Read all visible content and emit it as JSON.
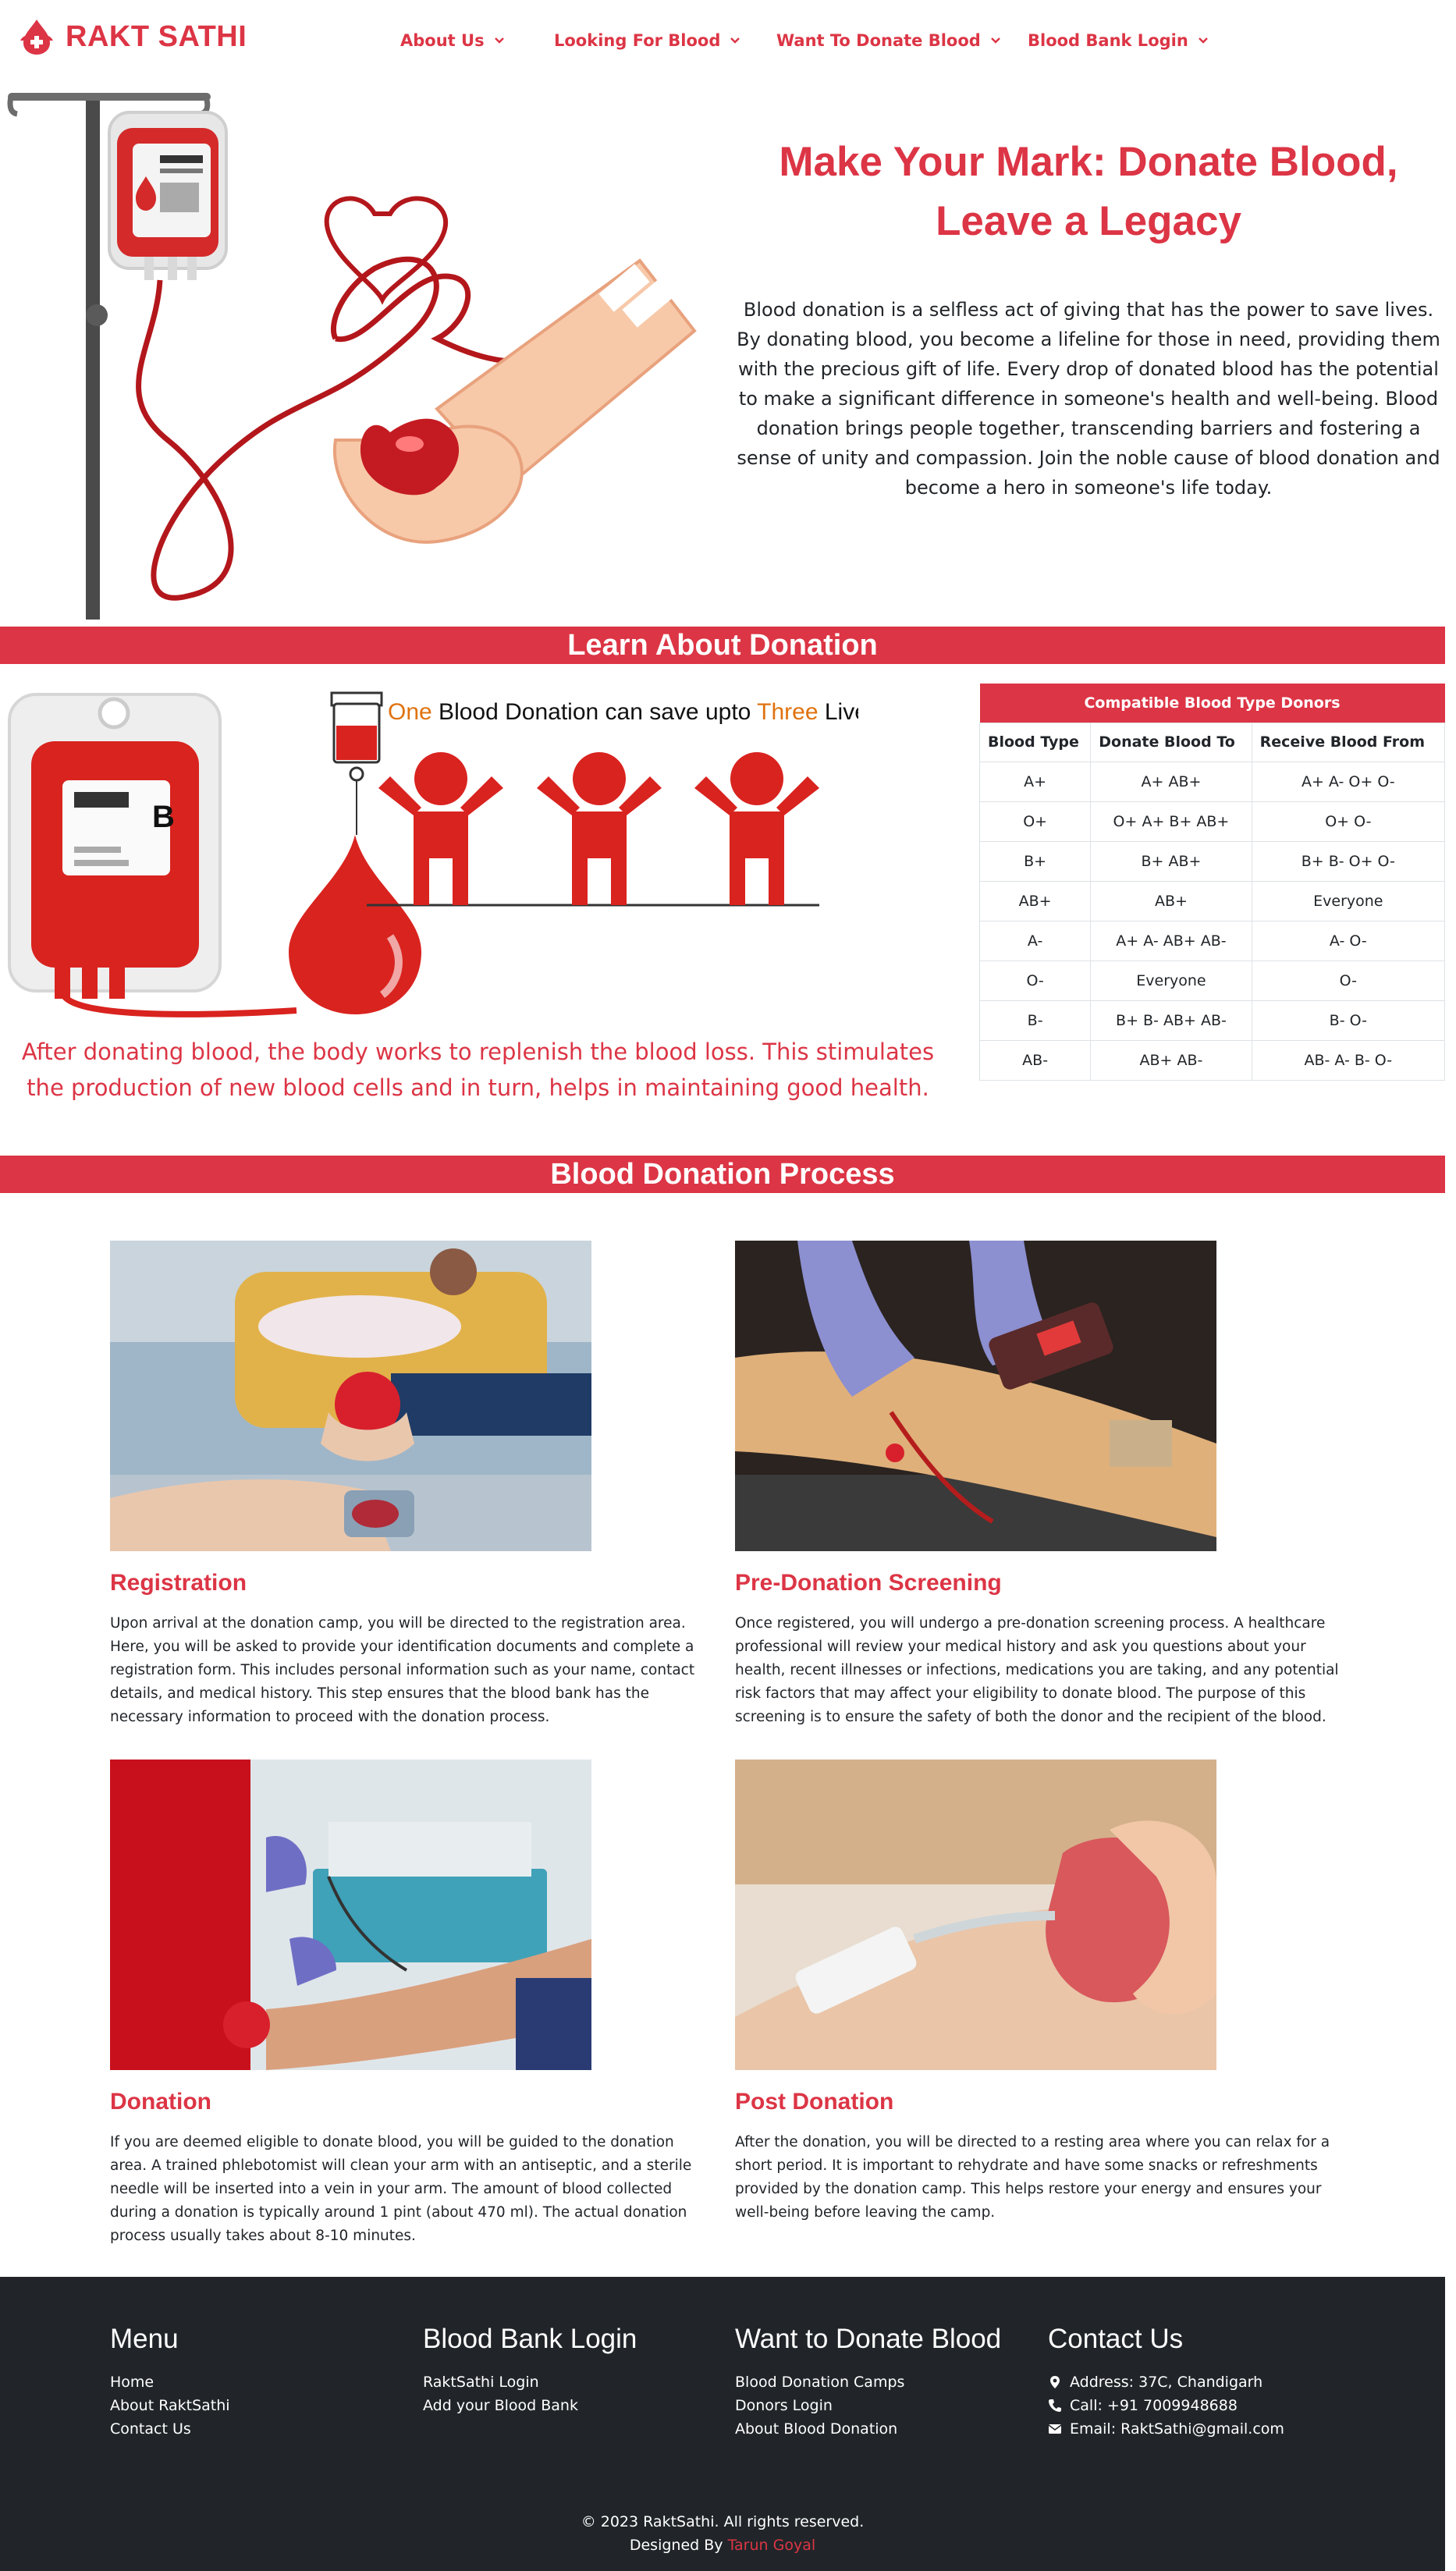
{
  "navbar": {
    "brand": "RAKT SATHI",
    "items": [
      {
        "label": "About Us"
      },
      {
        "label": "Looking For Blood"
      },
      {
        "label": "Want To Donate Blood"
      },
      {
        "label": "Blood Bank Login"
      }
    ]
  },
  "hero": {
    "title": "Make Your Mark: Donate Blood, Leave a Legacy",
    "text": "Blood donation is a selfless act of giving that has the power to save lives. By donating blood, you become a lifeline for those in need, providing them with the precious gift of life. Every drop of donated blood has the potential to make a significant difference in someone's health and well-being. Blood donation brings people together, transcending barriers and fostering a sense of unity and compassion. Join the noble cause of blood donation and become a hero in someone's life today."
  },
  "learn": {
    "heading": "Learn About Donation",
    "infographic": {
      "word_one": "One",
      "middle": " Blood Donation can save upto ",
      "word_three": "Three",
      "end": " Lives",
      "bag_label": "B"
    },
    "caption": "After donating blood, the body works to replenish the blood loss. This stimulates the production of new blood cells and in turn, helps in maintaining good health.",
    "table": {
      "caption": "Compatible Blood Type Donors",
      "headers": [
        "Blood Type",
        "Donate Blood To",
        "Receive Blood From"
      ],
      "rows": [
        [
          "A+",
          "A+ AB+",
          "A+ A- O+ O-"
        ],
        [
          "O+",
          "O+ A+ B+ AB+",
          "O+ O-"
        ],
        [
          "B+",
          "B+ AB+",
          "B+ B- O+ O-"
        ],
        [
          "AB+",
          "AB+",
          "Everyone"
        ],
        [
          "A-",
          "A+ A- AB+ AB-",
          "A- O-"
        ],
        [
          "O-",
          "Everyone",
          "O-"
        ],
        [
          "B-",
          "B+ B- AB+ AB-",
          "B- O-"
        ],
        [
          "AB-",
          "AB+ AB-",
          "AB- A- B- O-"
        ]
      ]
    }
  },
  "process": {
    "heading": "Blood Donation Process",
    "steps": [
      {
        "title": "Registration",
        "text": "Upon arrival at the donation camp, you will be directed to the registration area. Here, you will be asked to provide your identification documents and complete a registration form. This includes personal information such as your name, contact details, and medical history. This step ensures that the blood bank has the necessary information to proceed with the donation process."
      },
      {
        "title": "Pre-Donation Screening",
        "text": "Once registered, you will undergo a pre-donation screening process. A healthcare professional will review your medical history and ask you questions about your health, recent illnesses or infections, medications you are taking, and any potential risk factors that may affect your eligibility to donate blood. The purpose of this screening is to ensure the safety of both the donor and the recipient of the blood."
      },
      {
        "title": "Donation",
        "text": "If you are deemed eligible to donate blood, you will be guided to the donation area. A trained phlebotomist will clean your arm with an antiseptic, and a sterile needle will be inserted into a vein in your arm. The amount of blood collected during a donation is typically around 1 pint (about 470 ml). The actual donation process usually takes about 8-10 minutes."
      },
      {
        "title": "Post Donation",
        "text": "After the donation, you will be directed to a resting area where you can relax for a short period. It is important to rehydrate and have some snacks or refreshments provided by the donation camp. This helps restore your energy and ensures your well-being before leaving the camp."
      }
    ]
  },
  "footer": {
    "menu": {
      "title": "Menu",
      "links": [
        "Home",
        "About RaktSathi",
        "Contact Us"
      ]
    },
    "bank": {
      "title": "Blood Bank Login",
      "links": [
        "RaktSathi Login",
        "Add your Blood Bank"
      ]
    },
    "donate": {
      "title": "Want to Donate Blood",
      "links": [
        "Blood Donation Camps",
        "Donors Login",
        "About Blood Donation"
      ]
    },
    "contact": {
      "title": "Contact Us",
      "address": "Address: 37C, Chandigarh",
      "phone": "Call: +91 7009948688",
      "email": "Email: RaktSathi@gmail.com"
    },
    "copyright": "© 2023 RaktSathi. All rights reserved.",
    "designed_by": "Designed By ",
    "designer": "Tarun Goyal"
  },
  "colors": {
    "accent": "#dc3545",
    "footer_bg": "#212529"
  },
  "icons": [
    "blood-drop-logo-icon",
    "chevron-down-icon",
    "map-marker-icon",
    "phone-icon",
    "envelope-icon"
  ]
}
